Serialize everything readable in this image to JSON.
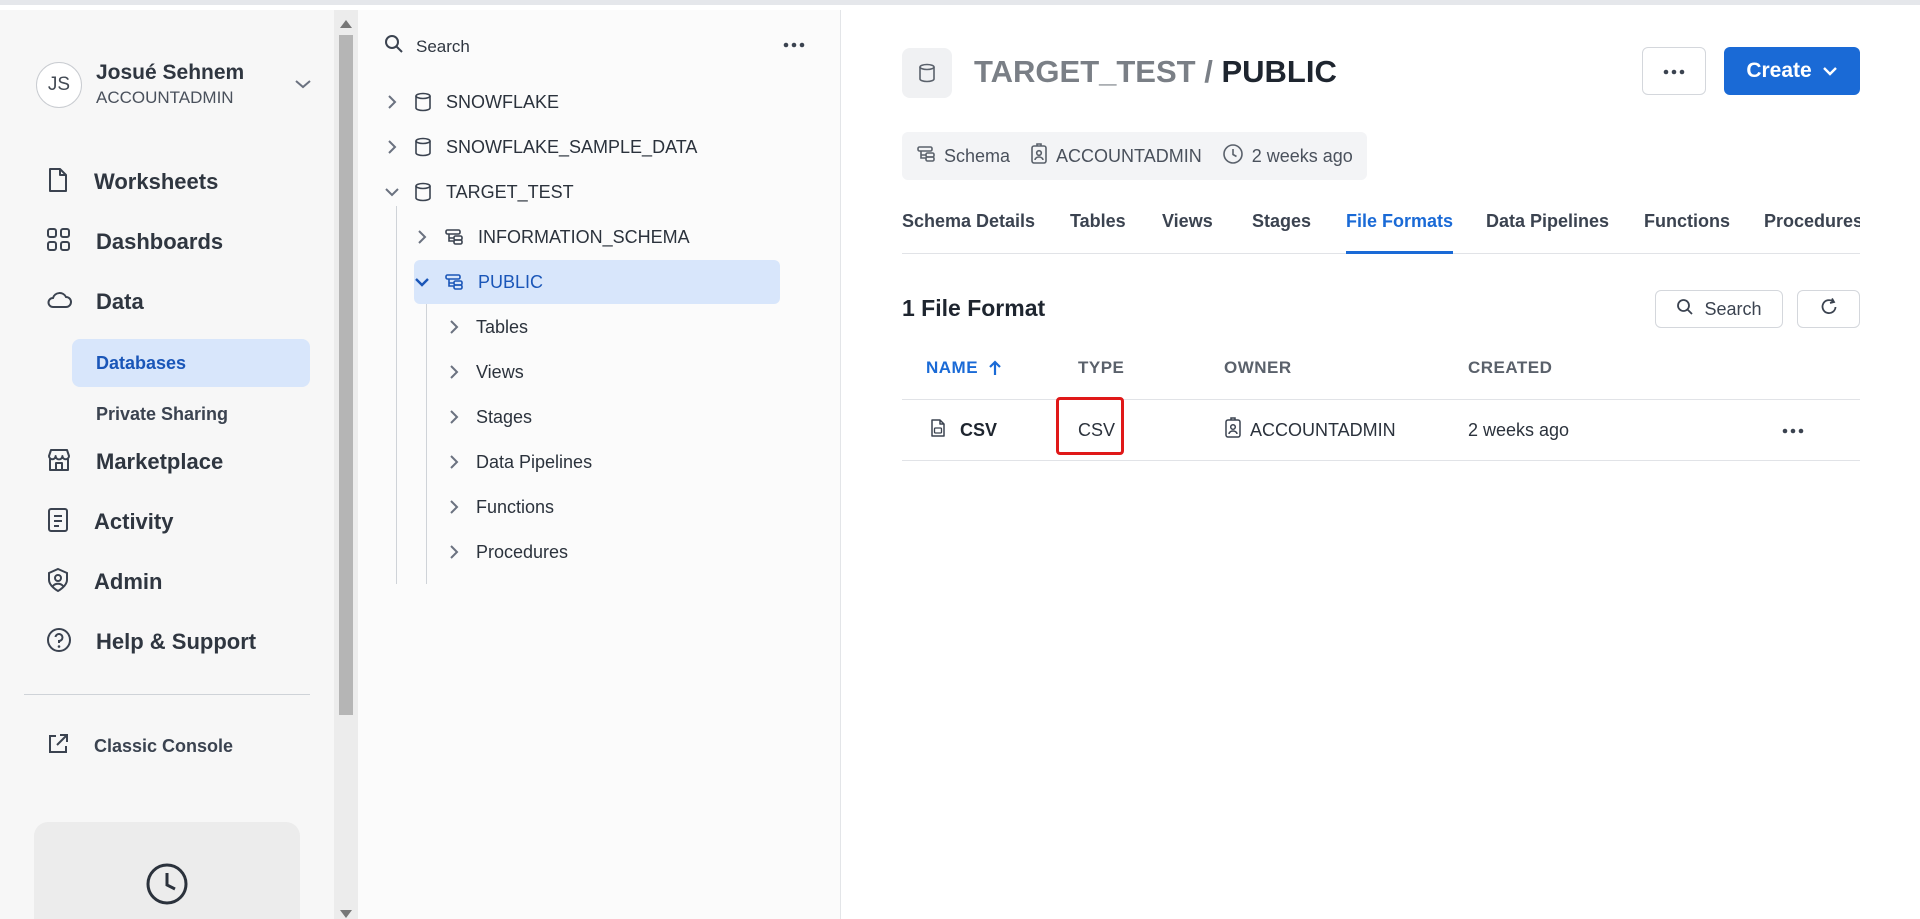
{
  "user": {
    "initials": "JS",
    "name": "Josué Sehnem",
    "role": "ACCOUNTADMIN"
  },
  "nav": {
    "worksheets": "Worksheets",
    "dashboards": "Dashboards",
    "data": "Data",
    "databases": "Databases",
    "private_sharing": "Private Sharing",
    "marketplace": "Marketplace",
    "activity": "Activity",
    "admin": "Admin",
    "help": "Help & Support",
    "classic_console": "Classic Console"
  },
  "tree": {
    "search_label": "Search",
    "databases": [
      "SNOWFLAKE",
      "SNOWFLAKE_SAMPLE_DATA",
      "TARGET_TEST"
    ],
    "schemas": [
      "INFORMATION_SCHEMA",
      "PUBLIC"
    ],
    "objects": [
      "Tables",
      "Views",
      "Stages",
      "Data Pipelines",
      "Functions",
      "Procedures"
    ]
  },
  "header": {
    "database": "TARGET_TEST",
    "separator": "/",
    "schema": "PUBLIC",
    "create_label": "Create",
    "meta": {
      "type": "Schema",
      "owner": "ACCOUNTADMIN",
      "created": "2 weeks ago"
    }
  },
  "tabs": [
    "Schema Details",
    "Tables",
    "Views",
    "Stages",
    "File Formats",
    "Data Pipelines",
    "Functions",
    "Procedures"
  ],
  "active_tab": "File Formats",
  "list": {
    "count_label": "1 File Format",
    "search_label": "Search",
    "columns": [
      "NAME",
      "TYPE",
      "OWNER",
      "CREATED"
    ],
    "rows": [
      {
        "name": "CSV",
        "type": "CSV",
        "owner": "ACCOUNTADMIN",
        "created": "2 weeks ago"
      }
    ]
  },
  "colors": {
    "accent": "#1a6ad6",
    "selected_bg": "#d8e6fb",
    "highlight": "#e01818"
  }
}
